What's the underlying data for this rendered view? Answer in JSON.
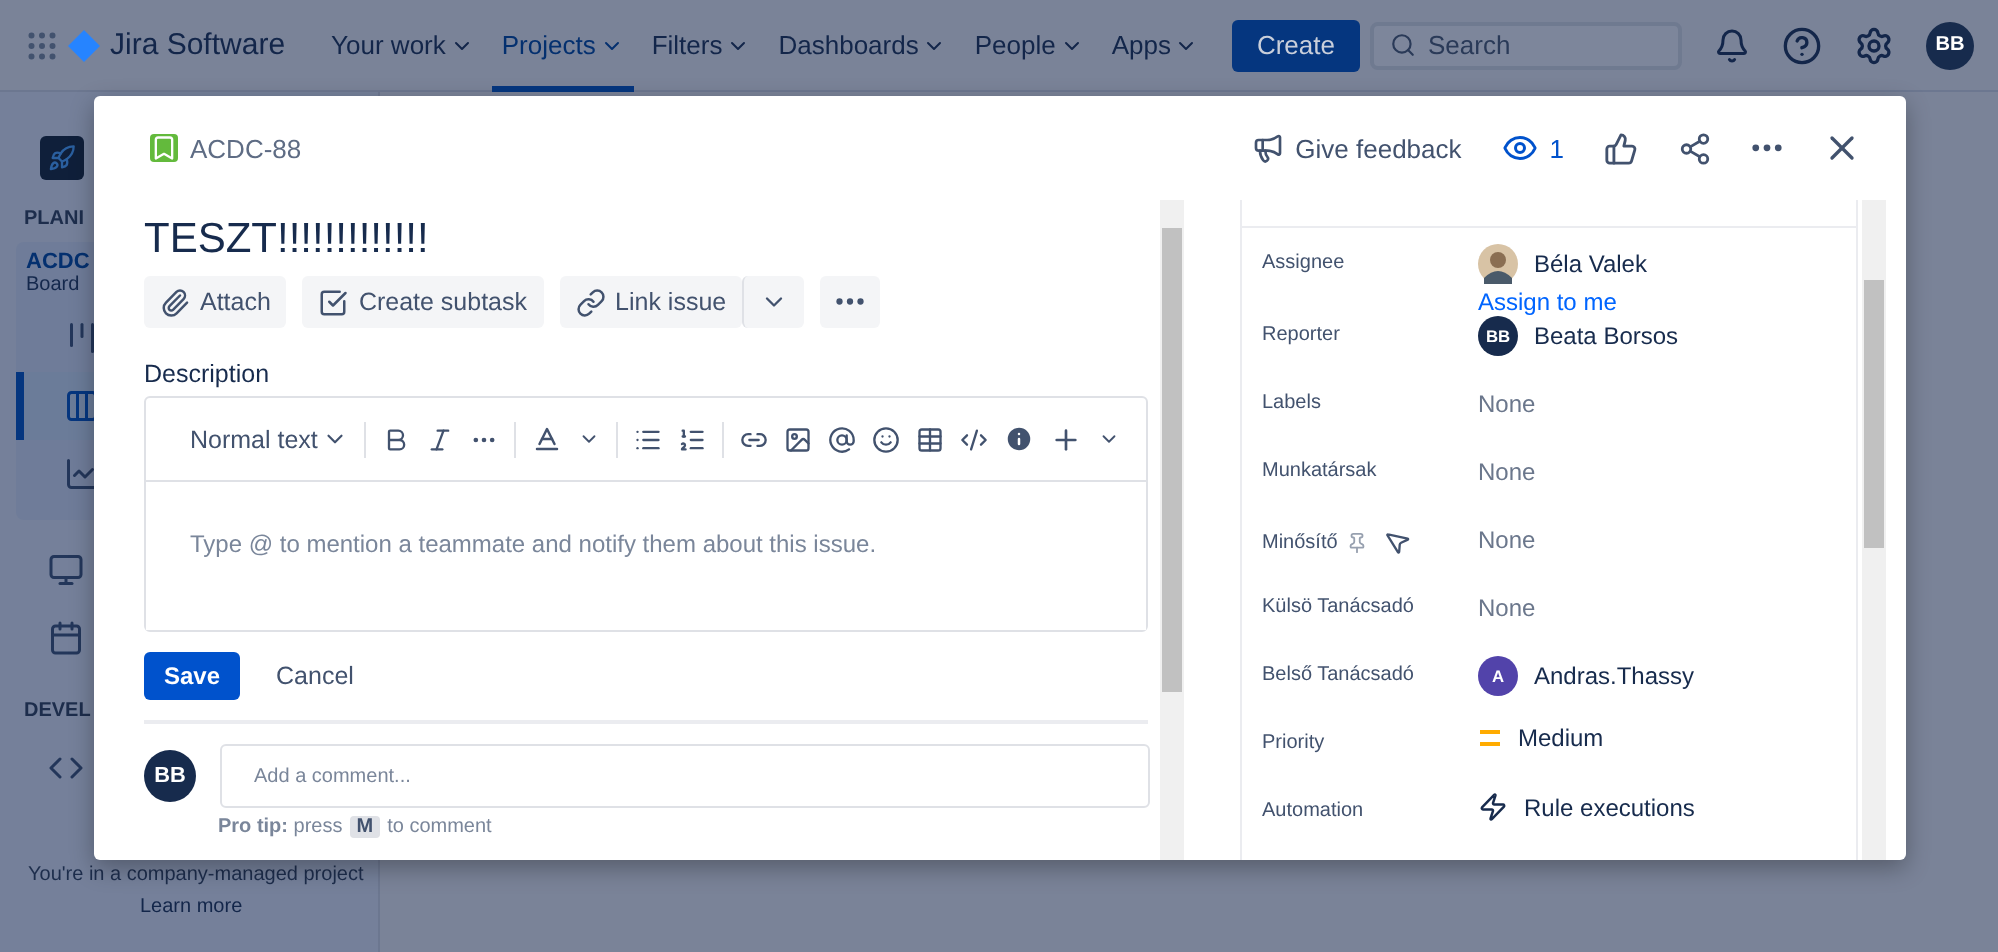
{
  "nav": {
    "product": "Jira Software",
    "items": [
      {
        "label": "Your work",
        "selected": false
      },
      {
        "label": "Projects",
        "selected": true
      },
      {
        "label": "Filters",
        "selected": false
      },
      {
        "label": "Dashboards",
        "selected": false
      },
      {
        "label": "People",
        "selected": false
      },
      {
        "label": "Apps",
        "selected": false
      }
    ],
    "create": "Create",
    "search_placeholder": "Search",
    "avatar": "BB"
  },
  "sidebar": {
    "planning_header": "PLANI",
    "project_name": "ACDC",
    "project_sub": "Board",
    "items": [
      {
        "kind": "timeline",
        "selected": false
      },
      {
        "kind": "board",
        "selected": true
      },
      {
        "kind": "reports",
        "selected": false
      },
      {
        "kind": "pages",
        "selected": false
      },
      {
        "kind": "releases",
        "selected": false
      }
    ],
    "dev_header": "DEVEL",
    "dev_items": [
      {
        "kind": "code",
        "selected": false
      }
    ],
    "footer": "You're in a company-managed project",
    "learn_more": "Learn more"
  },
  "issue": {
    "key": "ACDC-88",
    "title": "TESZT!!!!!!!!!!!!!",
    "header_actions": {
      "feedback": "Give feedback",
      "watchers": "1"
    },
    "actions": [
      "Attach",
      "Create subtask",
      "Link issue"
    ],
    "description_label": "Description",
    "text_style": "Normal text",
    "description_placeholder": "Type @ to mention a teammate and notify them about this issue.",
    "save": "Save",
    "cancel": "Cancel",
    "comment": {
      "avatar": "BB",
      "placeholder": "Add a comment...",
      "tip": "**Pro tip:** press",
      "key": "M",
      "tip_end": "to comment"
    },
    "fields": [
      {
        "label": "Assignee",
        "value": "Béla Valek",
        "link": "Assign to me"
      },
      {
        "label": "Reporter",
        "kind": "user",
        "value": "Beata Borsos",
        "initials": "BB",
        "color": "#172b4d"
      },
      {
        "label": "Labels",
        "kind": "none",
        "value": "None"
      },
      {
        "label": "Munkatársak",
        "kind": "none",
        "value": "None"
      },
      {
        "label": "Minősítő",
        "kind": "none",
        "value": "None",
        "pinned": true
      },
      {
        "label": "Külsö Tanácsadó",
        "kind": "none",
        "value": "None"
      },
      {
        "label": "Belső Tanácsadó",
        "kind": "user",
        "value": "Andras.Thassy",
        "initials": "A",
        "color": "#5243aa"
      },
      {
        "label": "Priority",
        "kind": "priority",
        "value": "Medium"
      },
      {
        "label": "Automation",
        "kind": "automation",
        "value": "Rule executions"
      }
    ]
  }
}
